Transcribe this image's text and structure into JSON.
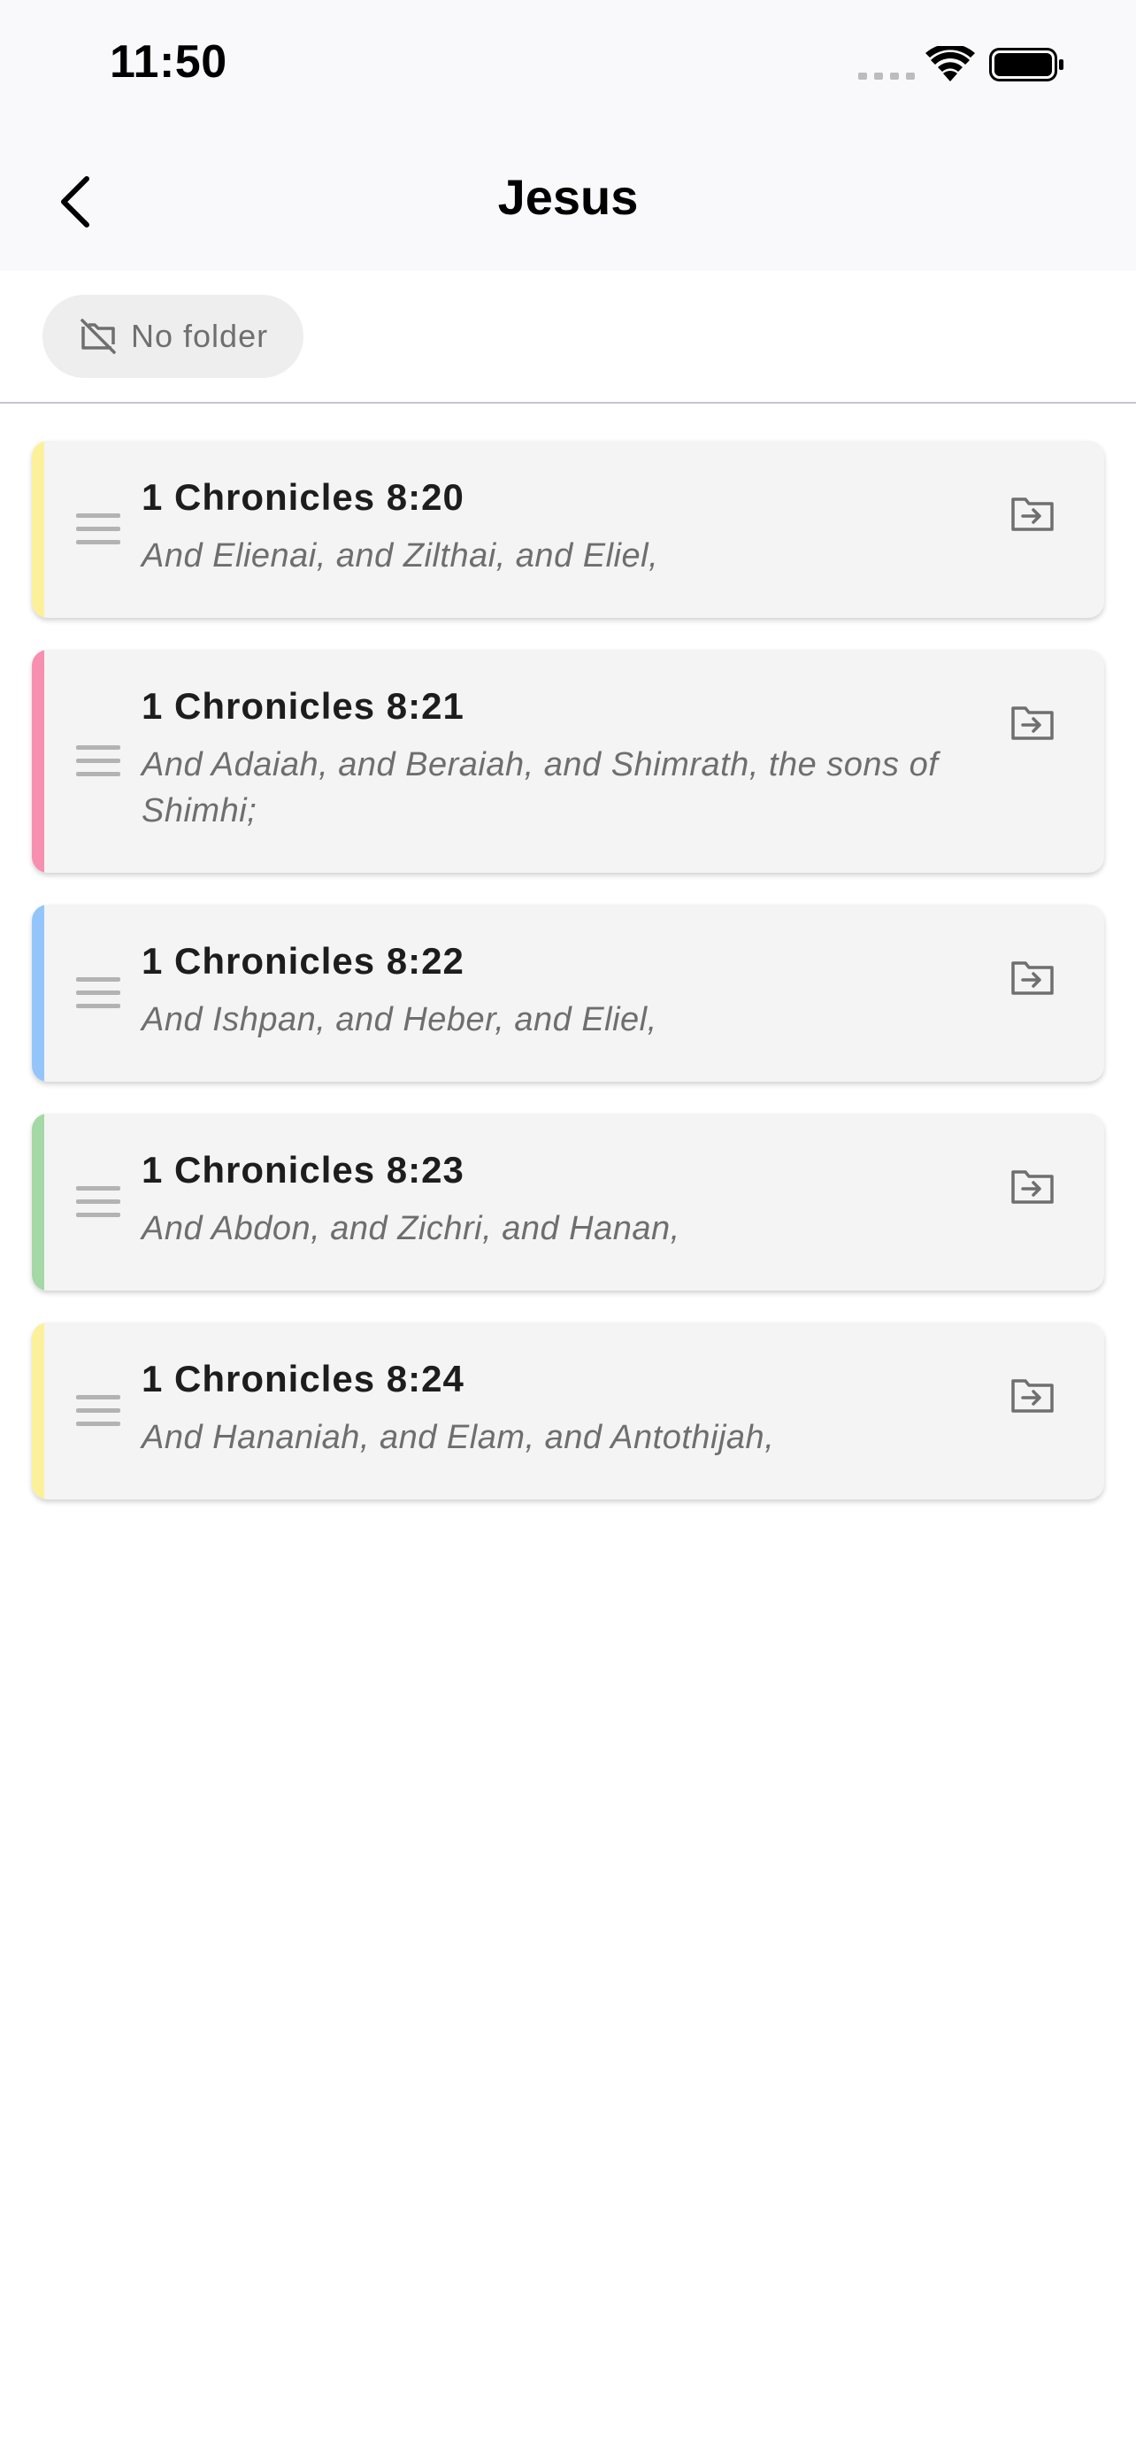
{
  "status_bar": {
    "time": "11:50"
  },
  "nav": {
    "title": "Jesus"
  },
  "filter": {
    "folder_label": "No folder"
  },
  "colors": {
    "yellow": "#fdf09a",
    "pink": "#f78fb0",
    "blue": "#93c5fb",
    "green": "#a4d8a6"
  },
  "verses": [
    {
      "reference": "1 Chronicles 8:20",
      "text": "And Elienai, and Zilthai, and Eliel,",
      "color": "#fdf09a"
    },
    {
      "reference": "1 Chronicles 8:21",
      "text": "And Adaiah, and Beraiah, and Shimrath, the sons of Shimhi;",
      "color": "#f78fb0"
    },
    {
      "reference": "1 Chronicles 8:22",
      "text": "And Ishpan, and Heber, and Eliel,",
      "color": "#93c5fb"
    },
    {
      "reference": "1 Chronicles 8:23",
      "text": "And Abdon, and Zichri, and Hanan,",
      "color": "#a4d8a6"
    },
    {
      "reference": "1 Chronicles 8:24",
      "text": "And Hananiah, and Elam, and Antothijah,",
      "color": "#fdf09a"
    }
  ]
}
